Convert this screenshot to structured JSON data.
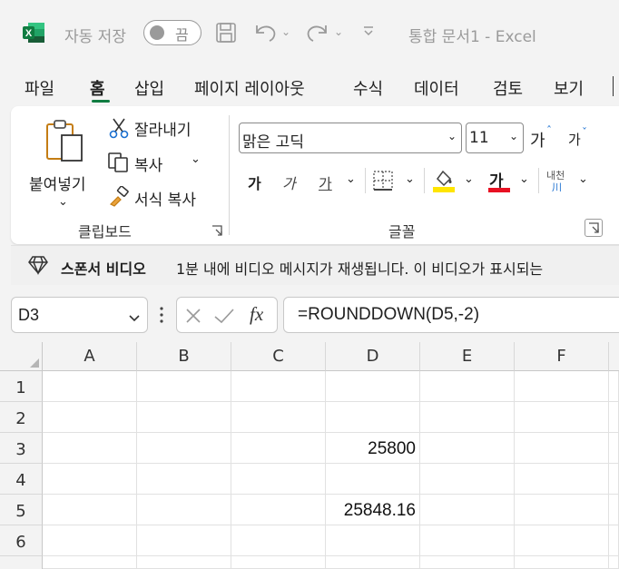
{
  "titlebar": {
    "autosave_label": "자동 저장",
    "autosave_state": "끔",
    "document_title": "통합 문서1  -  Excel"
  },
  "menu": {
    "tabs": [
      "파일",
      "홈",
      "삽입",
      "페이지 레이아웃",
      "수식",
      "데이터",
      "검토",
      "보기"
    ],
    "active": "홈"
  },
  "ribbon": {
    "clipboard": {
      "paste": "붙여넣기",
      "cut": "잘라내기",
      "copy": "복사",
      "format_painter": "서식 복사",
      "group_label": "클립보드"
    },
    "font": {
      "font_name": "맑은 고딕",
      "font_size": "11",
      "grow_glyph": "가",
      "shrink_glyph": "가",
      "bold_glyph": "가",
      "italic_glyph": "가",
      "underline_glyph": "가",
      "font_color_glyph": "가",
      "phonetic_top": "내천",
      "phonetic_bottom": "川",
      "group_label": "글꼴",
      "fill_color": "#ffe500",
      "font_color": "#e81123"
    }
  },
  "sponsor": {
    "title": "스폰서 비디오",
    "message": "1분 내에 비디오 메시지가 재생됩니다. 이 비디오가 표시되는"
  },
  "formula_bar": {
    "name_box": "D3",
    "fx": "fx",
    "formula": "=ROUNDDOWN(D5,-2)"
  },
  "sheet": {
    "columns": [
      "A",
      "B",
      "C",
      "D",
      "E",
      "F"
    ],
    "rows": [
      "1",
      "2",
      "3",
      "4",
      "5",
      "6"
    ],
    "cells": {
      "D3": "25800",
      "D5": "25848.16"
    }
  },
  "colors": {
    "excel_green": "#107c41",
    "tab_underline": "#107c41"
  }
}
